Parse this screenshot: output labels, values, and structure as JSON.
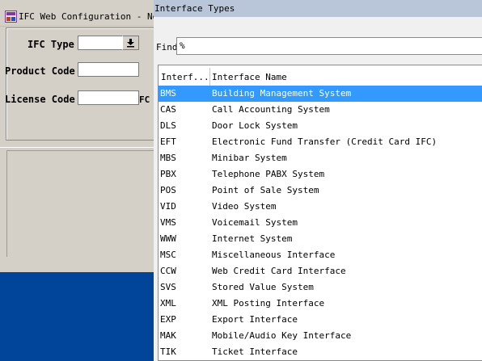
{
  "bg_window": {
    "title": "IFC Web Configuration - New",
    "ifc_type_label": "IFC Type",
    "product_code_label": "Product Code",
    "license_code_label": "License Code",
    "fc_fragment": "FC",
    "ifc_type_value": "",
    "product_code_value": "",
    "license_code_value": ""
  },
  "dialog": {
    "title": "Interface Types",
    "find_label": "Find",
    "find_value": "%",
    "columns": [
      "Interf...",
      "Interface Name"
    ],
    "rows": [
      {
        "code": "BMS",
        "name": "Building Management System",
        "selected": true
      },
      {
        "code": "CAS",
        "name": "Call Accounting System"
      },
      {
        "code": "DLS",
        "name": "Door Lock System"
      },
      {
        "code": "EFT",
        "name": "Electronic Fund Transfer (Credit Card IFC)"
      },
      {
        "code": "MBS",
        "name": "Minibar System"
      },
      {
        "code": "PBX",
        "name": "Telephone PABX System"
      },
      {
        "code": "POS",
        "name": "Point of Sale System"
      },
      {
        "code": "VID",
        "name": "Video System"
      },
      {
        "code": "VMS",
        "name": "Voicemail System"
      },
      {
        "code": "WWW",
        "name": "Internet System"
      },
      {
        "code": "MSC",
        "name": "Miscellaneous Interface"
      },
      {
        "code": "CCW",
        "name": "Web Credit Card Interface"
      },
      {
        "code": "SVS",
        "name": "Stored Value System"
      },
      {
        "code": "XML",
        "name": "XML Posting Interface"
      },
      {
        "code": "EXP",
        "name": "Export Interface"
      },
      {
        "code": "MAK",
        "name": "Mobile/Audio Key Interface"
      },
      {
        "code": "TIK",
        "name": "Ticket Interface"
      }
    ]
  },
  "colors": {
    "selection": "#3399ff",
    "desktop_blue": "#00459a",
    "dialog_titlebar": "#b9c6d9"
  }
}
